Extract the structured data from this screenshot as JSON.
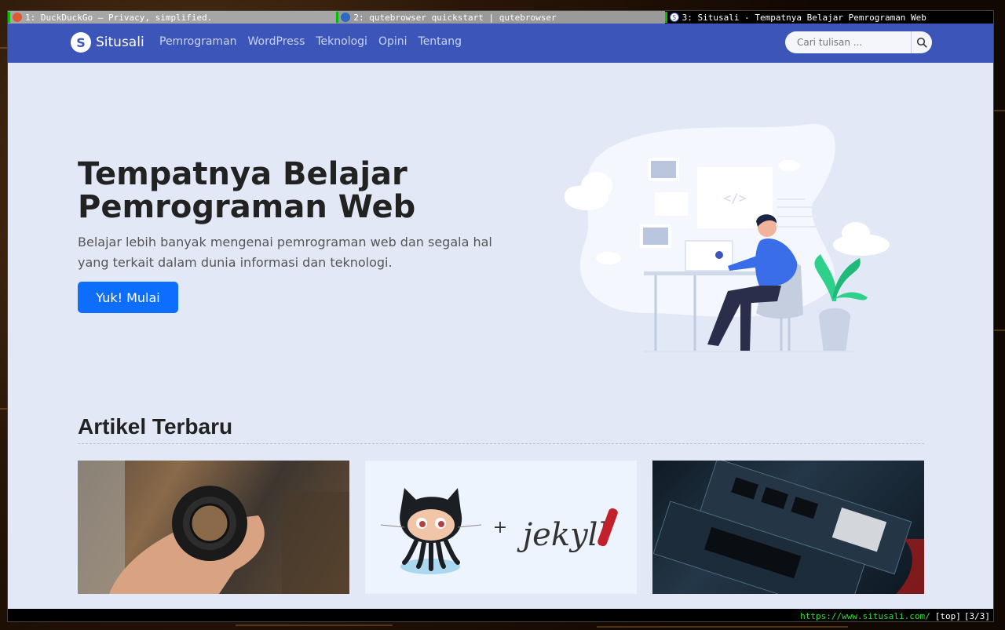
{
  "tabs": [
    {
      "number": "1:",
      "title": "DuckDuckGo — Privacy, simplified.",
      "favicon": "duckduckgo-icon"
    },
    {
      "number": "2:",
      "title": "qutebrowser quickstart | qutebrowser",
      "favicon": "qutebrowser-icon"
    },
    {
      "number": "3:",
      "title": "Situsali - Tempatnya Belajar Pemrograman Web",
      "favicon": "situsali-icon"
    }
  ],
  "navbar": {
    "brand": "Situsali",
    "links": [
      "Pemrograman",
      "WordPress",
      "Teknologi",
      "Opini",
      "Tentang"
    ],
    "search_placeholder": "Cari tulisan ..."
  },
  "hero": {
    "title": "Tempatnya Belajar Pemrograman Web",
    "subtitle": "Belajar lebih banyak mengenai pemrograman web dan segala hal yang terkait dalam dunia informasi dan teknologi.",
    "button": "Yuk! Mulai"
  },
  "articles": {
    "title": "Artikel Terbaru",
    "cards": [
      {
        "image": "camera-lens-photo"
      },
      {
        "image": "github-jekyll-logo",
        "plus": "+",
        "jekyll": "jekyll"
      },
      {
        "image": "ssd-hardware-photo"
      }
    ]
  },
  "statusbar": {
    "url": "https://www.situsali.com/",
    "position": "[top]",
    "tab_index": "[3/3]"
  },
  "colors": {
    "navbar": "#3c55b8",
    "page_bg": "#e3e8f6",
    "primary_button": "#0d6efd",
    "status_url": "#33dd33"
  }
}
